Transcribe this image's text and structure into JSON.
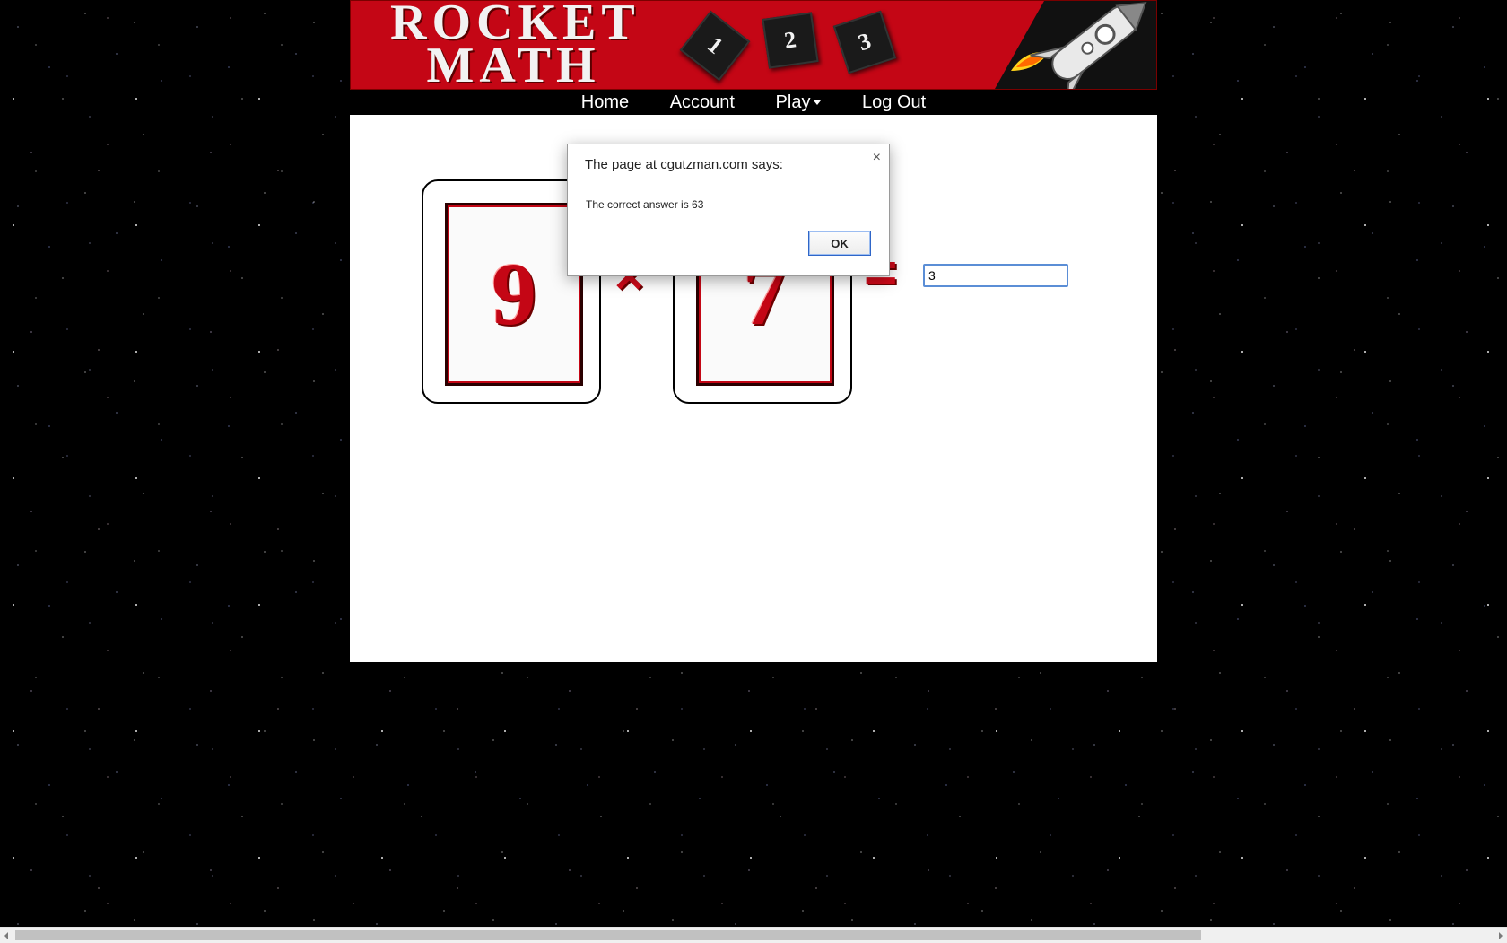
{
  "header": {
    "logo_line1": "ROCKET",
    "logo_line2": "MATH",
    "tiles": [
      "1",
      "2",
      "3"
    ],
    "banner_color": "#c40615"
  },
  "nav": {
    "items": [
      {
        "label": "Home"
      },
      {
        "label": "Account"
      },
      {
        "label": "Play",
        "has_dropdown": true
      },
      {
        "label": "Log Out"
      }
    ]
  },
  "problem": {
    "operand1": "9",
    "operator": "×",
    "operand2": "7",
    "equals": "=",
    "answer_value": "3"
  },
  "dialog": {
    "title": "The page at cgutzman.com says:",
    "message": "The correct answer is 63",
    "ok_label": "OK",
    "close_icon": "×"
  },
  "colors": {
    "accent": "#c40615",
    "background": "#000000",
    "content": "#ffffff"
  }
}
